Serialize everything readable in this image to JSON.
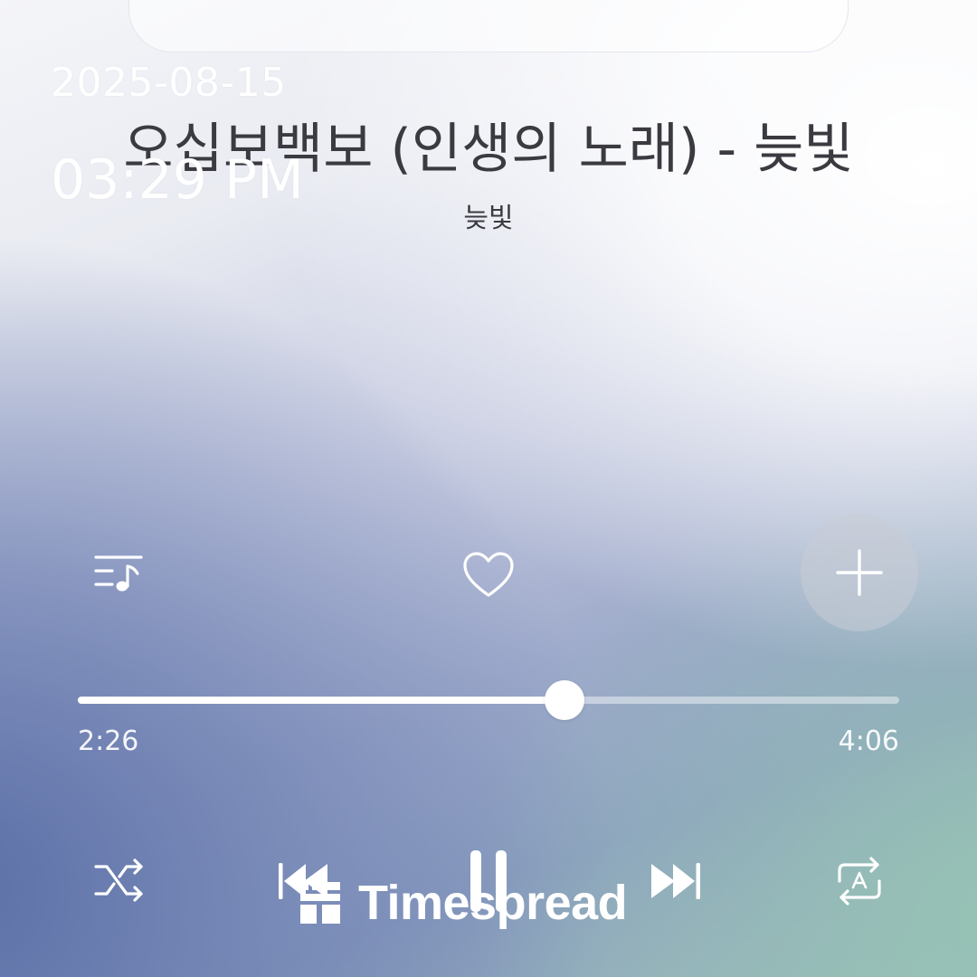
{
  "overlay": {
    "date": "2025-08-15",
    "time": "03:29 PM"
  },
  "track": {
    "title": "오십보백보 (인생의 노래) - 늦빛",
    "artist": "늦빛"
  },
  "actions": {
    "playlist_icon": "playlist-music-icon",
    "like_icon": "heart-outline-icon",
    "add_icon": "plus-icon"
  },
  "progress": {
    "elapsed": "2:26",
    "total": "4:06",
    "fraction": 0.593
  },
  "controls": {
    "shuffle_icon": "shuffle-icon",
    "previous_icon": "skip-previous-icon",
    "pause_icon": "pause-icon",
    "next_icon": "skip-next-icon",
    "repeat_icon": "repeat-icon"
  },
  "watermark": {
    "text": "Timespread"
  },
  "colors": {
    "text_dark": "#3a3a40",
    "accent_white": "#ffffff",
    "gradient_blue": "#5c70a8",
    "gradient_teal": "#96c3b4"
  }
}
